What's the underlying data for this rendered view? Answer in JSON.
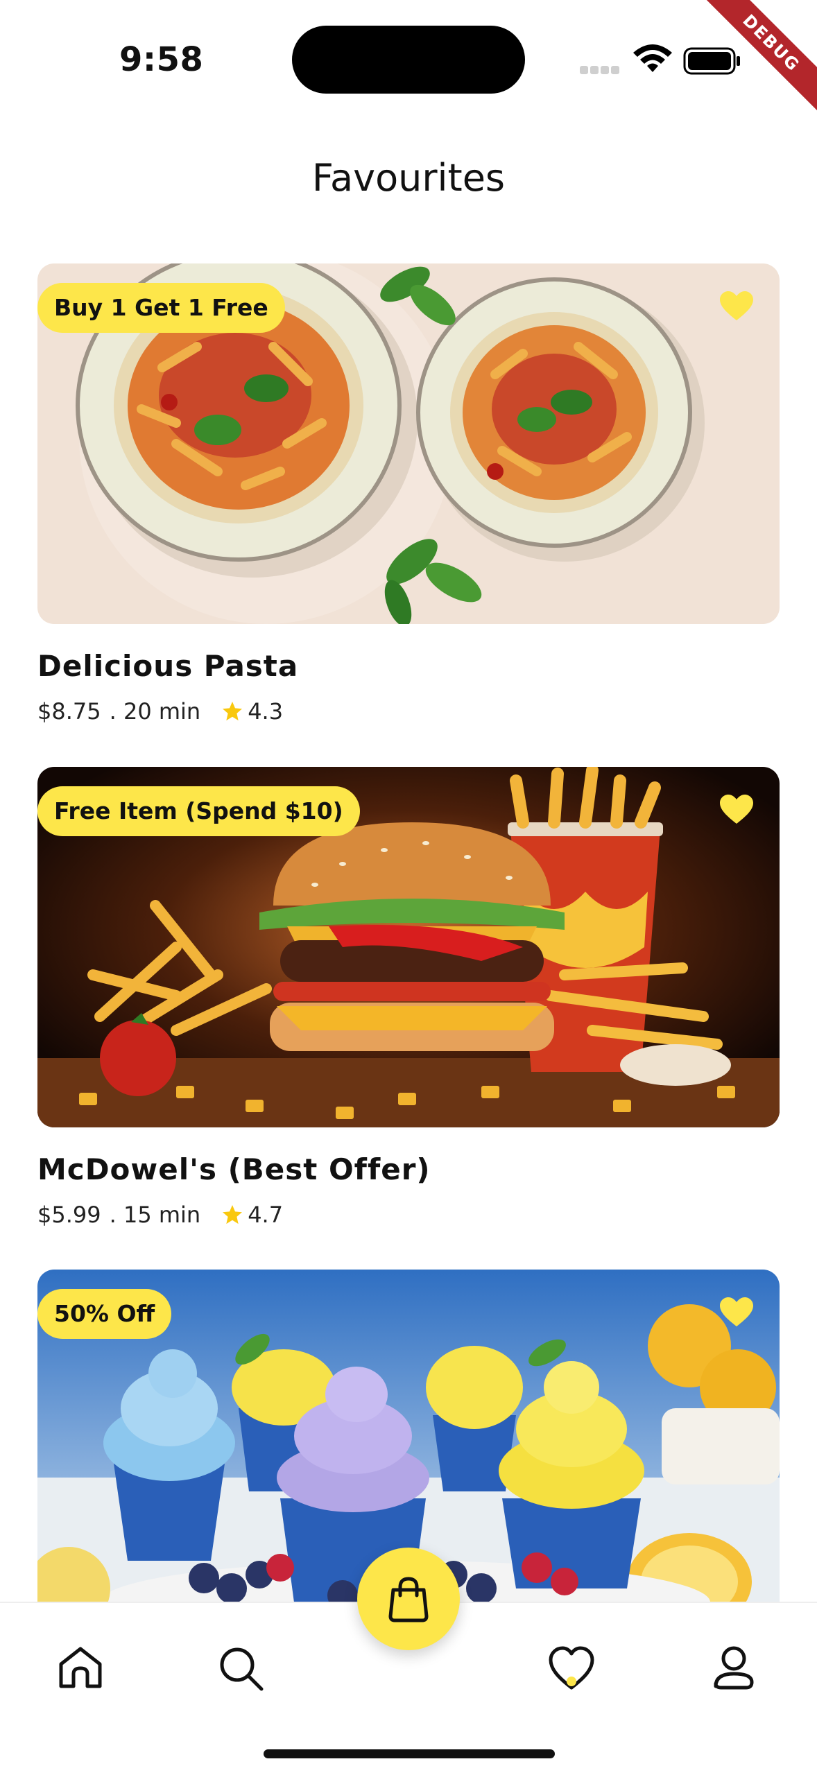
{
  "status_bar": {
    "time": "9:58",
    "debug_label": "DEBUG"
  },
  "header": {
    "title": "Favourites"
  },
  "items": [
    {
      "badge": "Buy 1 Get 1 Free",
      "name": "Delicious Pasta",
      "price": "$8.75",
      "time": ". 20 min",
      "rating": "4.3",
      "favorited": true
    },
    {
      "badge": "Free Item (Spend $10)",
      "name": "McDowel's (Best Offer)",
      "price": "$5.99",
      "time": ". 15 min",
      "rating": "4.7",
      "favorited": true
    },
    {
      "badge": "50% Off",
      "name": "",
      "price": "",
      "time": "",
      "rating": "",
      "favorited": true
    }
  ],
  "nav": {
    "items": [
      "home-icon",
      "search-icon",
      "cart-icon",
      "heart-icon",
      "profile-icon"
    ],
    "active": "heart-icon"
  },
  "colors": {
    "accent": "#fde64a",
    "text": "#111111",
    "background": "#ffffff"
  }
}
